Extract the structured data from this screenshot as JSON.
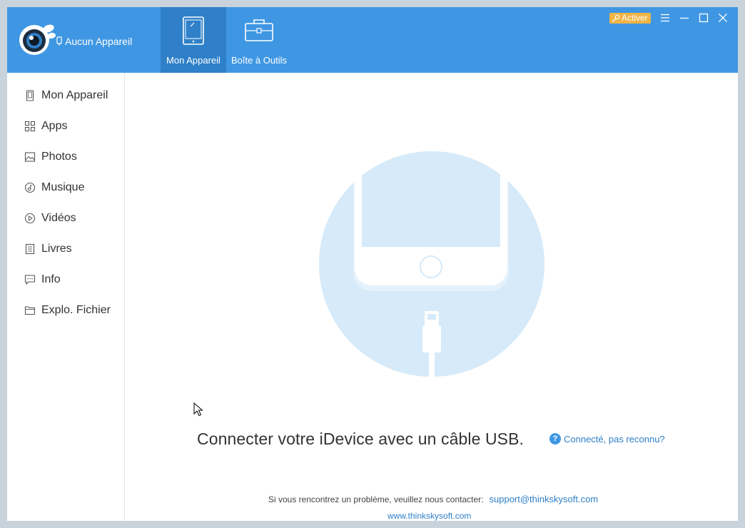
{
  "header": {
    "device_status": "Aucun Appareil",
    "tabs": [
      {
        "label": "Mon Appareil",
        "icon": "tablet-icon",
        "active": true
      },
      {
        "label": "Boîte à Outils",
        "icon": "toolbox-icon",
        "active": false
      }
    ],
    "activate_label": "Activer",
    "window_controls": [
      "menu-icon",
      "minimize-icon",
      "maximize-icon",
      "close-icon"
    ]
  },
  "sidebar": {
    "items": [
      {
        "label": "Mon Appareil",
        "icon": "phone-icon"
      },
      {
        "label": "Apps",
        "icon": "apps-grid-icon"
      },
      {
        "label": "Photos",
        "icon": "image-icon"
      },
      {
        "label": "Musique",
        "icon": "music-icon"
      },
      {
        "label": "Vidéos",
        "icon": "play-icon"
      },
      {
        "label": "Livres",
        "icon": "book-icon"
      },
      {
        "label": "Info",
        "icon": "message-icon"
      },
      {
        "label": "Explo. Fichier",
        "icon": "folder-icon"
      }
    ]
  },
  "main": {
    "connect_message": "Connecter votre iDevice avec un câble USB.",
    "help_link": "Connecté, pas reconnu?",
    "contact_text": "Si vous rencontrez un problème, veuillez nous contacter:",
    "support_email": "support@thinkskysoft.com",
    "website": "www.thinkskysoft.com"
  },
  "colors": {
    "header_blue": "#3f97e3",
    "active_tab": "#2f80c8",
    "activate_badge": "#f0b545",
    "illustration_light": "#d6eaf9"
  }
}
